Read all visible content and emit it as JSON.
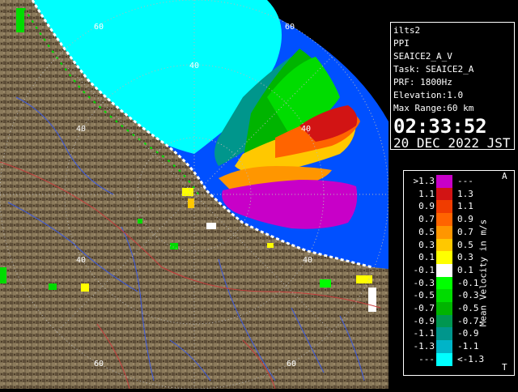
{
  "info": {
    "station": "ilts2",
    "scan_type": "PPI",
    "product": "SEAICE2_A_V",
    "task": "Task: SEAICE2_A",
    "prf": "PRF: 1800Hz",
    "elevation": "Elevation:1.0",
    "max_range": "Max Range:60 km",
    "time": "02:33:52",
    "date": "20 DEC 2022 JST"
  },
  "legend": {
    "title": "Mean Velocity in m/s",
    "top_letter": "A",
    "bottom_letter": "T",
    "rows": [
      {
        "left": ">1.3",
        "right": "---",
        "color": "#c800c8"
      },
      {
        "left": "1.1",
        "right": "1.3",
        "color": "#d21414"
      },
      {
        "left": "0.9",
        "right": "1.1",
        "color": "#f03c00"
      },
      {
        "left": "0.7",
        "right": "0.9",
        "color": "#ff6400"
      },
      {
        "left": "0.5",
        "right": "0.7",
        "color": "#ff9600"
      },
      {
        "left": "0.3",
        "right": "0.5",
        "color": "#ffc800"
      },
      {
        "left": "0.1",
        "right": "0.3",
        "color": "#ffff00"
      },
      {
        "left": "-0.1",
        "right": "0.1",
        "color": "#ffffff"
      },
      {
        "left": "-0.3",
        "right": "-0.1",
        "color": "#00ff00"
      },
      {
        "left": "-0.5",
        "right": "-0.3",
        "color": "#00dc00"
      },
      {
        "left": "-0.7",
        "right": "-0.5",
        "color": "#00b400"
      },
      {
        "left": "-0.9",
        "right": "-0.7",
        "color": "#009650"
      },
      {
        "left": "-1.1",
        "right": "-0.9",
        "color": "#00968c"
      },
      {
        "left": "-1.3",
        "right": "-1.1",
        "color": "#00b4c8"
      },
      {
        "left": "---",
        "right": "<-1.3",
        "color": "#00ffff"
      }
    ]
  },
  "range_rings": {
    "labels": [
      "40",
      "60",
      "40",
      "60",
      "40",
      "40",
      "40",
      "60",
      "60"
    ]
  },
  "colors": {
    "sea": "#0050ff",
    "land": "#7a6a4e",
    "land_dark": "#5a4a34",
    "ice_cyan": "#00ffff",
    "grid": "#b8b8b8",
    "river": "#3c5ae0",
    "border": "#c83c3c"
  }
}
